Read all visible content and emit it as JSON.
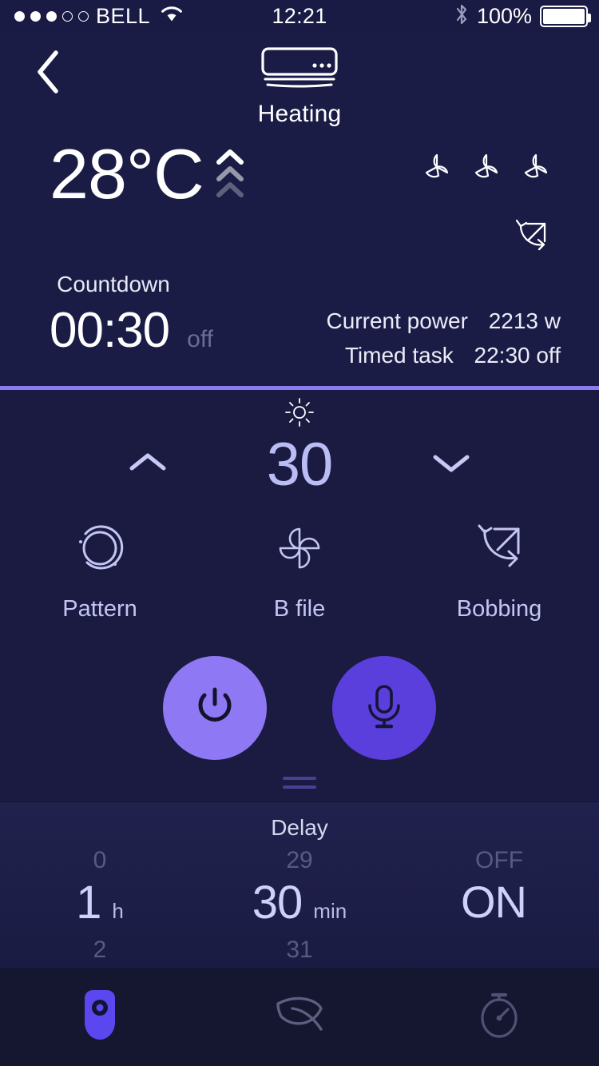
{
  "statusbar": {
    "carrier": "BELL",
    "signal_dots_total": 5,
    "signal_dots_filled": 3,
    "wifi_icon": "wifi-icon",
    "time": "12:21",
    "bluetooth_icon": "bluetooth-icon",
    "battery_percent": "100%",
    "battery_level": 100
  },
  "header": {
    "back_icon": "chevron-left-icon",
    "device_icon": "air-conditioner-icon",
    "device_name": "Heating"
  },
  "status": {
    "temperature": "28°C",
    "temp_trend_icon": "chevron-up-stack-icon",
    "countdown_label": "Countdown",
    "countdown_time": "00:30",
    "countdown_state": "off",
    "fan_speed_icons": [
      "fan-icon",
      "fan-icon",
      "fan-icon"
    ],
    "swing_icon": "swing-arrow-icon",
    "info": [
      {
        "key": "Current power",
        "value": "2213 w"
      },
      {
        "key": "Timed task",
        "value": "22:30 off"
      }
    ]
  },
  "control": {
    "brightness_icon": "sun-icon",
    "decrease_icon": "chevron-up-icon",
    "level_value": "30",
    "increase_icon": "chevron-down-icon",
    "modes": [
      {
        "icon": "pattern-circle-icon",
        "label": "Pattern"
      },
      {
        "icon": "pinwheel-fan-icon",
        "label": "B file"
      },
      {
        "icon": "bobbing-arrows-icon",
        "label": "Bobbing"
      }
    ],
    "power_button_icon": "power-icon",
    "mic_button_icon": "microphone-icon",
    "grabber_icon": "drag-handle-icon",
    "accent_power": "#8f78f4",
    "accent_mic": "#5b3fdd",
    "divider_color": "#8a7bf0"
  },
  "delay": {
    "title": "Delay",
    "pickers": [
      {
        "name": "hours",
        "prev": "0",
        "current": "1",
        "next": "2",
        "unit": "h"
      },
      {
        "name": "minutes",
        "prev": "29",
        "current": "30",
        "next": "31",
        "unit": "min"
      },
      {
        "name": "state",
        "prev": "OFF",
        "current": "ON",
        "next": "",
        "unit": ""
      }
    ]
  },
  "tabbar": {
    "tabs": [
      {
        "icon": "shield-dot-icon",
        "active": true
      },
      {
        "icon": "leaf-icon",
        "active": false
      },
      {
        "icon": "stopwatch-icon",
        "active": false
      }
    ]
  }
}
